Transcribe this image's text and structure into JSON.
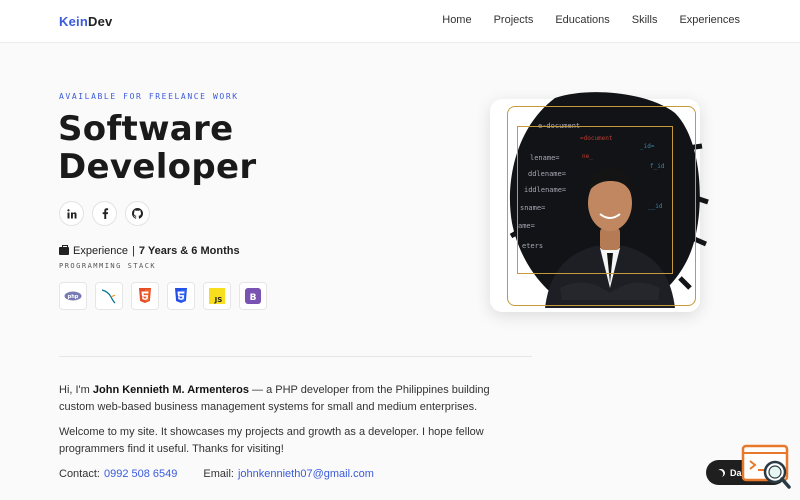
{
  "nav": {
    "brand_part1": "Kein",
    "brand_part2": "Dev",
    "links": [
      "Home",
      "Projects",
      "Educations",
      "Skills",
      "Experiences"
    ]
  },
  "hero": {
    "eyebrow": "AVAILABLE FOR FREELANCE WORK",
    "title_line1": "Software",
    "title_line2": "Developer",
    "socials": [
      {
        "icon": "linkedin-icon",
        "glyph": "in"
      },
      {
        "icon": "facebook-icon",
        "glyph": "f"
      },
      {
        "icon": "github-icon",
        "glyph": "◉"
      }
    ],
    "experience_label": "Experience",
    "experience_value": "7 Years & 6 Months",
    "stack_label": "PROGRAMMING STACK",
    "stack": [
      {
        "icon": "php-icon",
        "glyph": "php"
      },
      {
        "icon": "mysql-icon",
        "glyph": "~"
      },
      {
        "icon": "html5-icon",
        "glyph": "5"
      },
      {
        "icon": "css3-icon",
        "glyph": "3"
      },
      {
        "icon": "javascript-icon",
        "glyph": "JS"
      },
      {
        "icon": "bootstrap-icon",
        "glyph": "B"
      }
    ]
  },
  "about": {
    "intro_prefix": "Hi, I'm ",
    "name": "John Kennieth M. Armenteros",
    "intro_suffix": " — a PHP developer from the Philippines building custom web-based business management systems for small and medium enterprises.",
    "welcome": "Welcome to my site. It showcases my projects and growth as a developer. I hope fellow programmers find it useful. Thanks for visiting!"
  },
  "contact": {
    "contact_label": "Contact:",
    "phone": "0992 508 6549",
    "email_label": "Email:",
    "email": "johnkennieth07@gmail.com"
  },
  "dark_mode": {
    "label": "Dark Mo"
  },
  "colors": {
    "accent": "#3b5bdb",
    "gold": "#c69a3a",
    "php": "#777bb3",
    "html": "#e44d26",
    "css": "#264de4",
    "js": "#f7df1e",
    "bootstrap": "#7952b3"
  }
}
